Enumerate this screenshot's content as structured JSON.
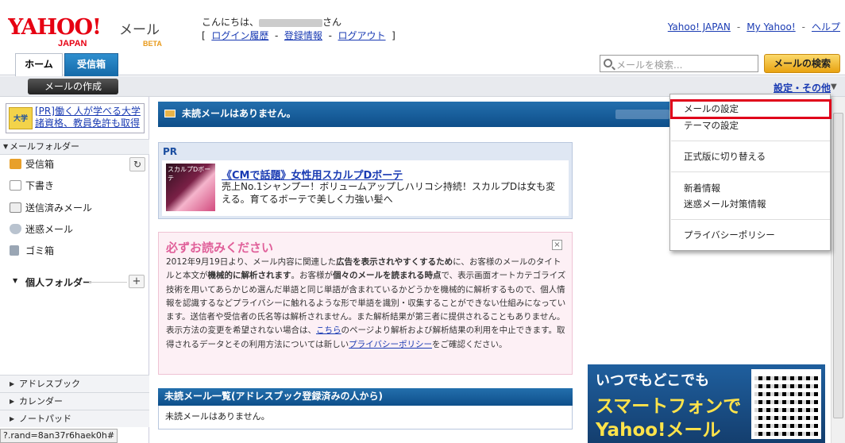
{
  "header": {
    "logo_text": "YAHOO! JAPAN",
    "product": "メール",
    "beta": "BETA",
    "greeting": "こんにちは、",
    "greeting_suffix": "さん",
    "account_links": [
      "ログイン履歴",
      "登録情報",
      "ログアウト"
    ],
    "top_links": [
      "Yahoo! JAPAN",
      "My Yahoo!",
      "ヘルプ"
    ]
  },
  "tabs": [
    {
      "label": "ホーム"
    },
    {
      "label": "受信箱"
    }
  ],
  "search": {
    "placeholder": "メールを検索...",
    "button": "メールの検索"
  },
  "toolbar": {
    "compose": "メールの作成",
    "settings": "設定・その他"
  },
  "sidebar": {
    "ad_text": "[PR]働く人が学べる大学 諸資格、教員免許も取得",
    "ad_icon": "大学",
    "folders_header": "メールフォルダー",
    "folders": [
      {
        "label": "受信箱",
        "icon": "inbox-icon"
      },
      {
        "label": "下書き",
        "icon": "draft-icon"
      },
      {
        "label": "送信済みメール",
        "icon": "sent-icon"
      },
      {
        "label": "迷惑メール",
        "icon": "spam-icon"
      },
      {
        "label": "ゴミ箱",
        "icon": "trash-icon"
      }
    ],
    "personal_folders": "個人フォルダー",
    "bottom_sections": [
      "アドレスブック",
      "カレンダー",
      "ノートパッド"
    ]
  },
  "status_url": "?.rand=8an37r6haek0h#",
  "main": {
    "unread_bar": "未読メールはありません。",
    "pr": {
      "label": "PR",
      "image_text": "スカルプDボーテ",
      "title": "《CMで話題》女性用スカルプDボーテ",
      "body": "売上No.1シャンプー！ボリュームアップしハリコシ持続！スカルプDは女も変える。育てるボーテで美しく力強い髪へ"
    },
    "notice": {
      "title": "必ずお読みください",
      "close": "×",
      "p1_a": "2012年9月19日より、メール内容に関連した",
      "p1_b": "広告を表示されやすくするため",
      "p1_c": "に、お客様のメールのタイトルと本文が",
      "p1_d": "機械的に解析されます",
      "p1_e": "。お客様が",
      "p1_f": "個々のメールを読まれる時点",
      "p1_g": "で、表示画面オートカテゴライズ技術を用いてあらかじめ選んだ単語と同じ単語が含まれているかどうかを機械的に解析するもので、個人情報を認識するなどプライバシーに触れるような形で単語を識別・収集することができない仕組みになっています。送信者や受信者の氏名等は解析されません。また解析結果が第三者に提供されることもありません。",
      "p2_a": "表示方法の変更を希望されない場合は、",
      "p2_link": "こちら",
      "p2_b": "のページより解析および解析結果の利用を中止できます。取得されるデータとその利用方法については新しい",
      "p2_link2": "プライバシーポリシー",
      "p2_c": "をご確認ください。"
    },
    "list_header": "未読メール一覧(アドレスブック登録済みの人から)",
    "list_body": "未読メールはありません。"
  },
  "smartphone_ad": {
    "line1": "いつでもどこでも",
    "line2": "スマートフォンで",
    "line3": "Yahoo!メール"
  },
  "dropdown": {
    "items": [
      "メールの設定",
      "テーマの設定",
      "正式版に切り替える",
      "新着情報",
      "迷惑メール対策情報",
      "プライバシーポリシー"
    ],
    "highlight_color": "#e0001a"
  },
  "colors": {
    "brand_red": "#e60012",
    "blue_bar": "#1560a0",
    "accent_yellow": "#f5c23a"
  }
}
